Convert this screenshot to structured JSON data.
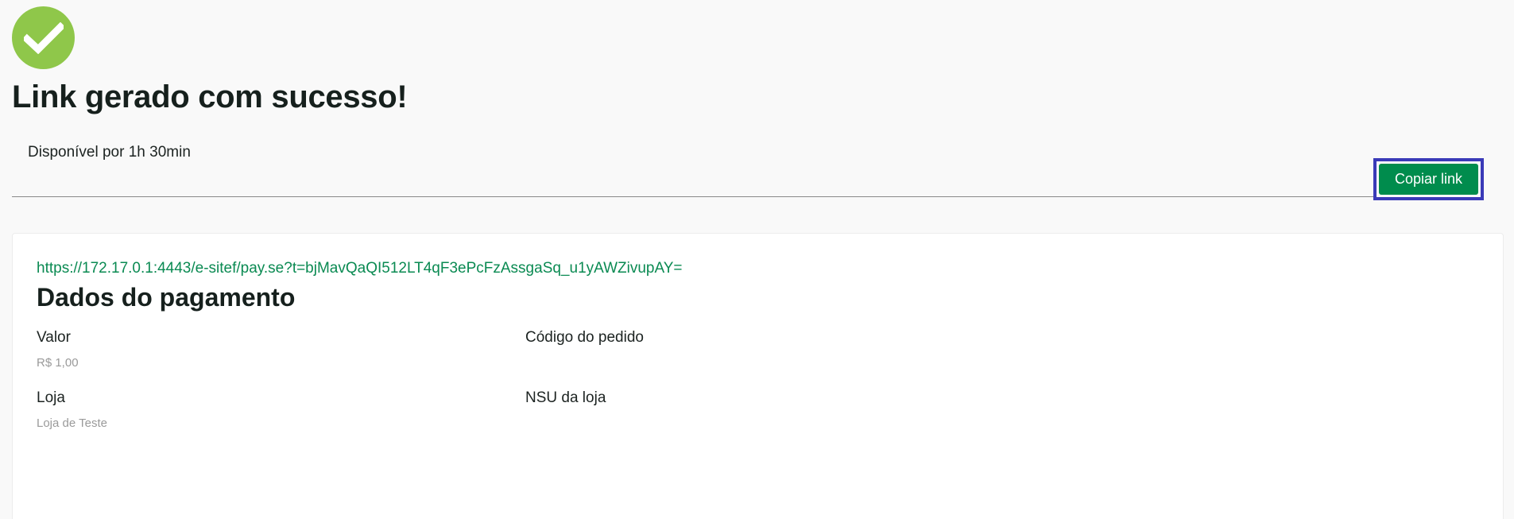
{
  "header": {
    "title": "Link gerado com sucesso!",
    "availability": "Disponível por 1h 30min",
    "copy_button_label": "Copiar link"
  },
  "colors": {
    "success_icon": "#8fc74a",
    "primary_button": "#008c4d",
    "link": "#0a8a52",
    "focus_ring": "#3a3ab8"
  },
  "payment": {
    "link": "https://172.17.0.1:4443/e-sitef/pay.se?t=bjMavQaQI512LT4qF3ePcFzAssgaSq_u1yAWZivupAY=",
    "section_title": "Dados do pagamento",
    "fields": {
      "valor": {
        "label": "Valor",
        "value": "R$ 1,00"
      },
      "codigo_pedido": {
        "label": "Código do pedido",
        "value": ""
      },
      "loja": {
        "label": "Loja",
        "value": "Loja de Teste"
      },
      "nsu_loja": {
        "label": "NSU da loja",
        "value": ""
      }
    }
  }
}
